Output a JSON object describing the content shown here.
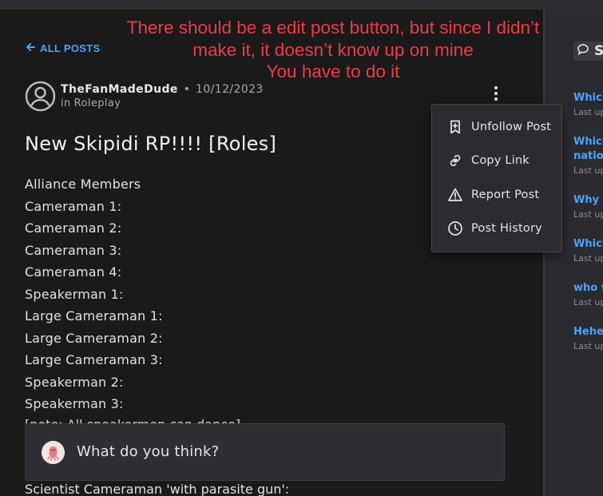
{
  "annotation": {
    "lines": [
      "There should be a edit post button, but since I didn’t",
      "make it, it doesn’t know up on mine",
      "You have to do it"
    ]
  },
  "nav": {
    "back_label": "ALL POSTS"
  },
  "post": {
    "author": "TheFanMadeDude",
    "separator": "•",
    "date": "10/12/2023",
    "community_prefix": "in",
    "community": "Roleplay",
    "title": "New Skipidi RP!!!! [Roles]",
    "body_lines": [
      "Alliance Members",
      "Cameraman 1:",
      "Cameraman 2:",
      "Cameraman 3:",
      "Cameraman 4:",
      "Speakerman 1:",
      "Large Cameraman 1:",
      "Large Cameraman 2:",
      "Large Cameraman 3:",
      "Speakerman 2:",
      "Speakerman 3:"
    ],
    "partial_line": "[note: All speakermen can dance]",
    "bottom_line": "Scientist Cameraman 'with parasite gun':"
  },
  "menu": {
    "items": [
      {
        "label": "Unfollow Post",
        "icon": "bookmark-icon"
      },
      {
        "label": "Copy Link",
        "icon": "link-icon"
      },
      {
        "label": "Report Post",
        "icon": "warning-icon"
      },
      {
        "label": "Post History",
        "icon": "clock-icon"
      }
    ]
  },
  "comment": {
    "placeholder": "What do you think?"
  },
  "sidebar": {
    "header": "S",
    "items": [
      {
        "title": "Which",
        "sub": "Last up"
      },
      {
        "title": "Which",
        "title2": "nation",
        "sub": "Last up"
      },
      {
        "title": "Why I",
        "sub": "Last up"
      },
      {
        "title": "Which",
        "sub": "Last up"
      },
      {
        "title": "who w",
        "sub": "Last up"
      },
      {
        "title": "Heheh",
        "sub": "Last up"
      }
    ]
  },
  "colors": {
    "accent": "#4aa3ff",
    "annotation": "#ee3b4a",
    "background": "#1a1a1a",
    "menu_bg": "#2b2c31"
  }
}
